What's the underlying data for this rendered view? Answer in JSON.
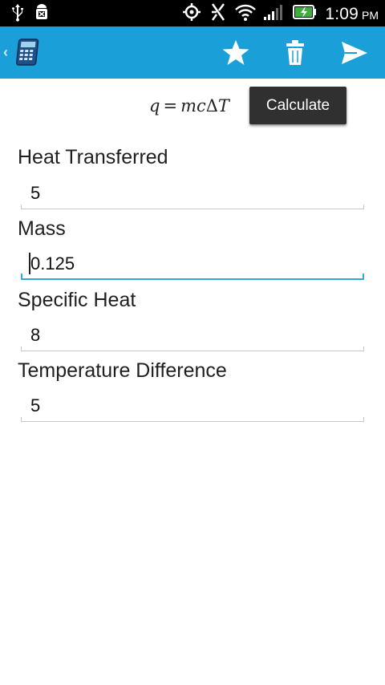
{
  "status_bar": {
    "time": "1:09",
    "ampm": "PM",
    "icons": [
      "usb-icon",
      "android-debug-icon",
      "gps-icon",
      "vibrate-icon",
      "wifi-icon",
      "signal-icon",
      "battery-charging-icon"
    ]
  },
  "action_bar": {
    "app_icon": "calculator-icon",
    "actions": [
      "star-icon",
      "trash-icon",
      "send-icon"
    ]
  },
  "formula": {
    "lhs": "q",
    "equals": "=",
    "rhs_vars": "mc",
    "delta": "Δ",
    "rhs_end": "T"
  },
  "calculate_label": "Calculate",
  "fields": [
    {
      "label": "Heat Transferred",
      "value": "5"
    },
    {
      "label": "Mass",
      "value": "0.125"
    },
    {
      "label": "Specific Heat",
      "value": "8"
    },
    {
      "label": "Temperature Difference",
      "value": "5"
    }
  ],
  "colors": {
    "action_bar": "#1a9fd8",
    "focus_underline": "#33a7d6",
    "button_bg": "#303030"
  }
}
